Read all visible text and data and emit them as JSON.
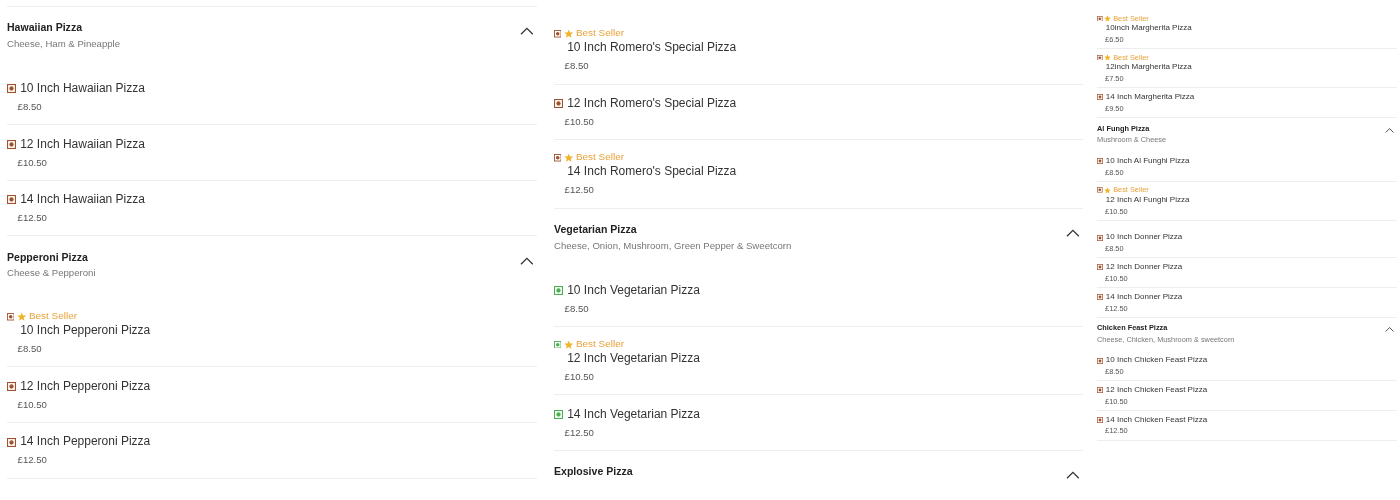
{
  "columns": [
    {
      "sections": [
        {
          "title": "Hawaiian Pizza",
          "description": "Cheese, Ham & Pineapple",
          "expanded": true,
          "items": [
            {
              "name": "10 Inch Hawaiian Pizza",
              "price": "£8.50",
              "best_seller": false,
              "veg": false
            },
            {
              "name": "12 Inch Hawaiian Pizza",
              "price": "£10.50",
              "best_seller": false,
              "veg": false
            },
            {
              "name": "14 Inch Hawaiian Pizza",
              "price": "£12.50",
              "best_seller": false,
              "veg": false
            }
          ]
        },
        {
          "title": "Pepperoni Pizza",
          "description": "Cheese & Pepperoni",
          "expanded": true,
          "items": [
            {
              "name": "10 Inch Pepperoni Pizza",
              "price": "£8.50",
              "best_seller": true,
              "badge": "Best Seller",
              "veg": false
            },
            {
              "name": "12 Inch Pepperoni Pizza",
              "price": "£10.50",
              "best_seller": false,
              "veg": false
            },
            {
              "name": "14 Inch Pepperoni Pizza",
              "price": "£12.50",
              "best_seller": false,
              "veg": false
            }
          ]
        }
      ]
    },
    {
      "sections": [
        {
          "items": [
            {
              "name": "10 Inch Romero's Special Pizza",
              "price": "£8.50",
              "best_seller": true,
              "badge": "Best Seller",
              "veg": false
            },
            {
              "name": "12 Inch Romero's Special Pizza",
              "price": "£10.50",
              "best_seller": false,
              "veg": false
            },
            {
              "name": "14 Inch Romero's Special Pizza",
              "price": "£12.50",
              "best_seller": true,
              "badge": "Best Seller",
              "veg": false
            }
          ]
        },
        {
          "title": "Vegetarian Pizza",
          "description": "Cheese, Onion, Mushroom, Green Pepper & Sweetcorn",
          "expanded": true,
          "items": [
            {
              "name": "10 Inch Vegetarian Pizza",
              "price": "£8.50",
              "best_seller": false,
              "veg": true
            },
            {
              "name": "12 Inch Vegetarian Pizza",
              "price": "£10.50",
              "best_seller": true,
              "badge": "Best Seller",
              "veg": true
            },
            {
              "name": "14 Inch Vegetarian Pizza",
              "price": "£12.50",
              "best_seller": false,
              "veg": true
            }
          ]
        },
        {
          "title": "Explosive Pizza",
          "expanded": true
        }
      ]
    },
    {
      "sections": [
        {
          "items": [
            {
              "name": "10inch Margherita Pizza",
              "price": "£6.50",
              "best_seller": true,
              "badge": "Best Seller",
              "veg": false
            },
            {
              "name": "12inch Margherita Pizza",
              "price": "£7.50",
              "best_seller": true,
              "badge": "Best Seller",
              "veg": false
            },
            {
              "name": "14 Inch Margherita Pizza",
              "price": "£9.50",
              "best_seller": false,
              "veg": false
            }
          ]
        },
        {
          "title": "Al Fungh Pizza",
          "description": "Mushroom & Cheese",
          "expanded": true,
          "items": [
            {
              "name": "10 Inch Al Funghi Pizza",
              "price": "£8.50",
              "best_seller": false,
              "veg": false
            },
            {
              "name": "12 Inch Al Funghi Pizza",
              "price": "£10.50",
              "best_seller": true,
              "badge": "Best Seller",
              "veg": false
            }
          ]
        },
        {
          "items": [
            {
              "name": "10 Inch Donner Pizza",
              "price": "£8.50",
              "best_seller": false,
              "veg": false
            },
            {
              "name": "12 Inch Donner Pizza",
              "price": "£10.50",
              "best_seller": false,
              "veg": false
            },
            {
              "name": "14 Inch Donner Pizza",
              "price": "£12.50",
              "best_seller": false,
              "veg": false
            }
          ]
        },
        {
          "title": "Chicken Feast Pizza",
          "description": "Cheese, Chicken, Mushroom & sweetcorn",
          "expanded": true,
          "items": [
            {
              "name": "10 Inch Chicken Feast Pizza",
              "price": "£8.50",
              "best_seller": false,
              "veg": false
            },
            {
              "name": "12 Inch Chicken Feast Pizza",
              "price": "£10.50",
              "best_seller": false,
              "veg": false
            },
            {
              "name": "14 Inch Chicken Feast Pizza",
              "price": "£12.50",
              "best_seller": false,
              "veg": false
            }
          ]
        }
      ]
    }
  ]
}
